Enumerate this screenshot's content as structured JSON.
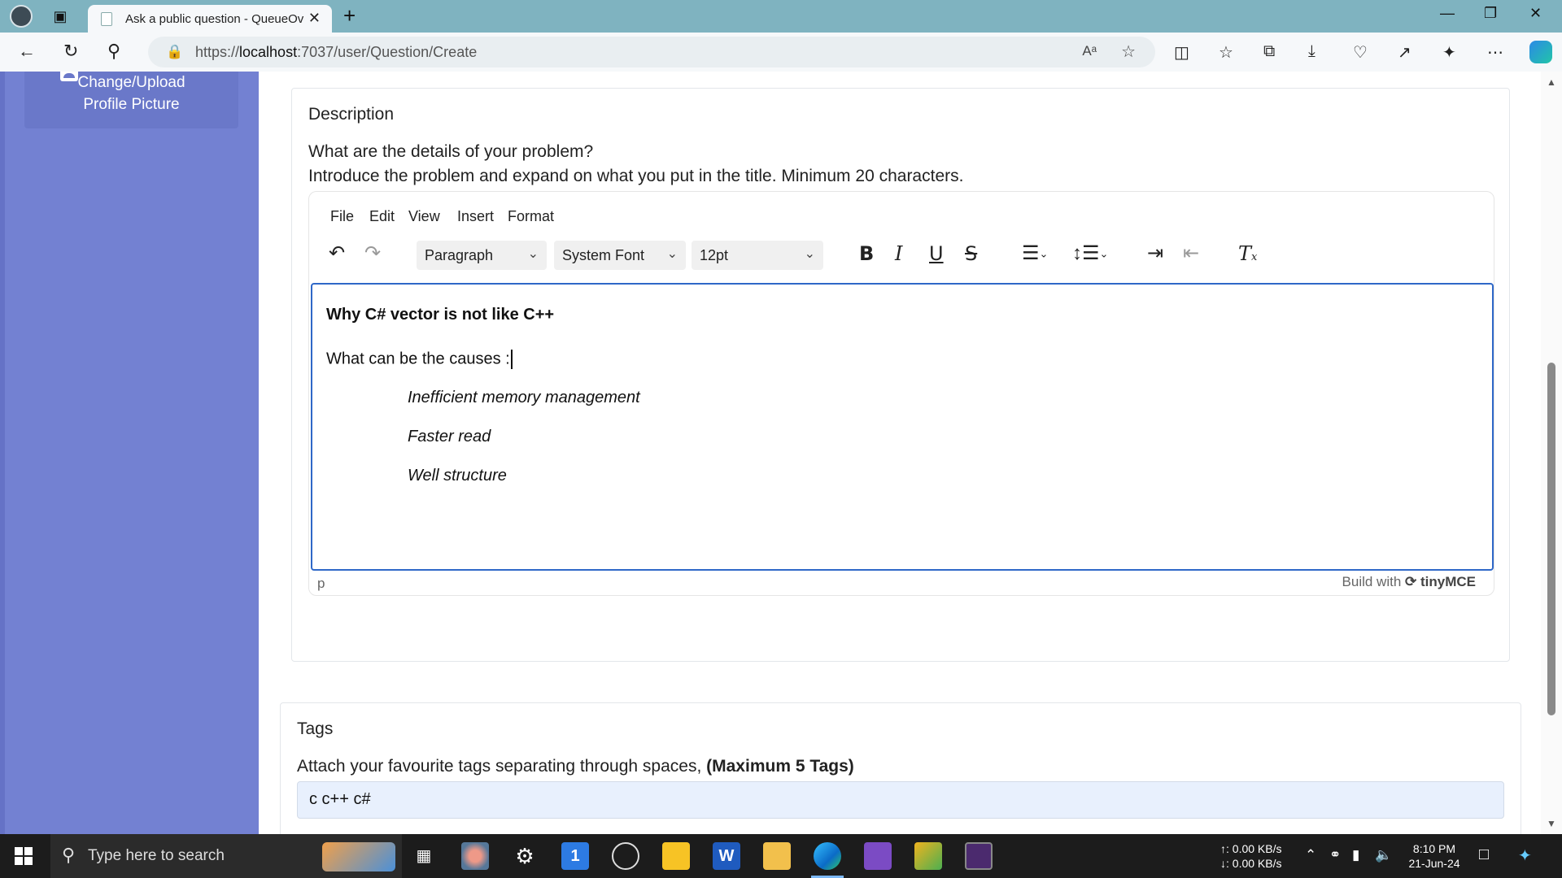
{
  "browser": {
    "tab_title": "Ask a public question - QueueOverflow",
    "url_prefix": "https://",
    "url_host": "localhost",
    "url_path": ":7037/user/Question/Create",
    "icons": {
      "read_aloud": "Aᵃ",
      "favorite": "☆"
    }
  },
  "sidebar": {
    "upload_button_line1": "Change/Upload",
    "upload_button_line2": "Profile Picture"
  },
  "description_card": {
    "heading": "Description",
    "line1": "What are the details of your problem?",
    "line2": "Introduce the problem and expand on what you put in the title. Minimum 20 characters."
  },
  "editor": {
    "menus": [
      "File",
      "Edit",
      "View",
      "Insert",
      "Format"
    ],
    "block_format": "Paragraph",
    "font_family": "System Font",
    "font_size": "12pt",
    "content": {
      "heading": "Why C# vector is not like C++",
      "question": "What can be the causes :",
      "items": [
        "Inefficient memory management",
        "Faster read",
        "Well structure"
      ]
    },
    "status_path": "p",
    "branding_prefix": "Build with",
    "branding_name": "tinyMCE"
  },
  "tags_card": {
    "heading": "Tags",
    "instruction": "Attach your favourite tags separating through spaces,",
    "instruction_bold": "(Maximum 5 Tags)",
    "input_value": "c c++ c#"
  },
  "taskbar": {
    "search_placeholder": "Type here to search",
    "net_up": "↑: 0.00 KB/s",
    "net_down": "↓: 0.00 KB/s",
    "time": "8:10 PM",
    "date": "21-Jun-24"
  },
  "colors": {
    "sidebar": "#7381d2",
    "editor_focus": "#2f68c8",
    "tab_bar": "#7fb3c0"
  }
}
